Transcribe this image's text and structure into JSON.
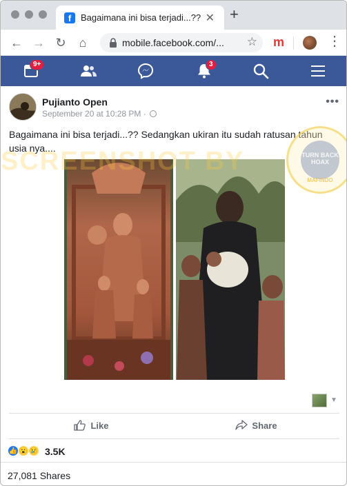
{
  "browser": {
    "tab_title": "Bagaimana ini bisa terjadi...?? S",
    "url": "mobile.facebook.com/...",
    "extension_label": "m"
  },
  "fb_nav": {
    "home_badge": "9+",
    "notifications_badge": "3",
    "bar_color": "#3b5998"
  },
  "post": {
    "author": "Pujianto Open",
    "timestamp": "September 20 at 10:28 PM · ",
    "text": "Bagaimana ini bisa terjadi...?? Sedangkan ukiran itu sudah ratusan tahun usia nya....",
    "watermark": "SCREENSHOT BY",
    "seal_text": "TURN BACK HOAX",
    "seal_name": "MAFINDO"
  },
  "actions": {
    "like_label": "Like",
    "share_label": "Share"
  },
  "stats": {
    "reaction_count": "3.5K",
    "shares": "27,081 Shares"
  }
}
